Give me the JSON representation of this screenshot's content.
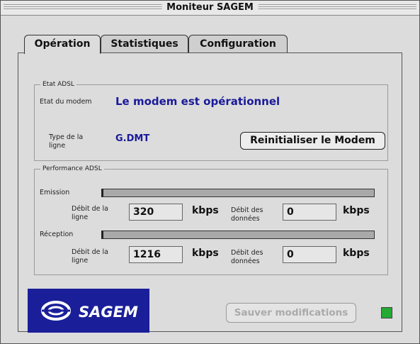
{
  "window": {
    "title": "Moniteur SAGEM"
  },
  "tabs": [
    {
      "label": "Opération",
      "active": true
    },
    {
      "label": "Statistiques",
      "active": false
    },
    {
      "label": "Configuration",
      "active": false
    }
  ],
  "etat": {
    "group_label": "Etat ADSL",
    "modem_state_label": "Etat du modem",
    "modem_state_value": "Le modem est opérationnel",
    "type_label_1": "Type de la",
    "type_label_2": "ligne",
    "type_value": "G.DMT",
    "reset_button": "Reinitialiser le Modem"
  },
  "performance": {
    "group_label": "Performance ADSL",
    "emission": {
      "label": "Emission",
      "line_rate_label_1": "Débit de la",
      "line_rate_label_2": "ligne",
      "line_rate_value": "320",
      "line_rate_unit": "kbps",
      "data_rate_label_1": "Débit des",
      "data_rate_label_2": "données",
      "data_rate_value": "0",
      "data_rate_unit": "kbps"
    },
    "reception": {
      "label": "Réception",
      "line_rate_label_1": "Débit de la",
      "line_rate_label_2": "ligne",
      "line_rate_value": "1216",
      "line_rate_unit": "kbps",
      "data_rate_label_1": "Débit des",
      "data_rate_label_2": "données",
      "data_rate_value": "0",
      "data_rate_unit": "kbps"
    }
  },
  "footer": {
    "logo_text": "SAGEM",
    "save_button": "Sauver modifications",
    "save_button_enabled": false,
    "status_led_color": "#22aa33"
  },
  "colors": {
    "accent_text": "#1a1a99",
    "logo_bg": "#1a1f99"
  }
}
